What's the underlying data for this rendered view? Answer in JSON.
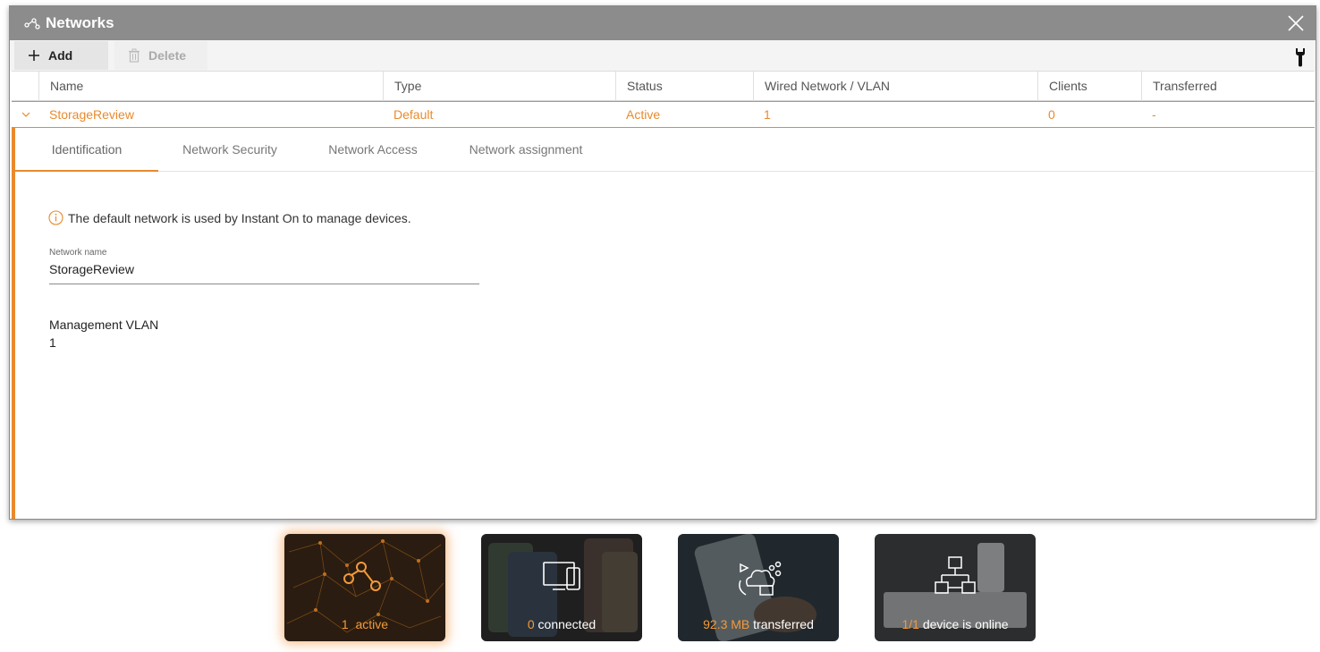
{
  "window": {
    "title": "Networks"
  },
  "toolbar": {
    "add_label": "Add",
    "delete_label": "Delete"
  },
  "table": {
    "columns": [
      "Name",
      "Type",
      "Status",
      "Wired Network / VLAN",
      "Clients",
      "Transferred"
    ],
    "rows": [
      {
        "name": "StorageReview",
        "type": "Default",
        "status": "Active",
        "vlan": "1",
        "clients": "0",
        "transferred": "-"
      }
    ]
  },
  "detail": {
    "tabs": [
      "Identification",
      "Network Security",
      "Network Access",
      "Network assignment"
    ],
    "active_tab": "Identification",
    "info_text": "The default network is used by Instant On to manage devices.",
    "network_name_label": "Network name",
    "network_name_value": "StorageReview",
    "management_vlan_label": "Management VLAN",
    "management_vlan_value": "1"
  },
  "tiles": [
    {
      "num": "1",
      "text": "active",
      "icon": "network-share-icon"
    },
    {
      "num": "0",
      "text": "connected",
      "icon": "devices-icon"
    },
    {
      "num": "92.3 MB",
      "text": "transferred",
      "icon": "cloud-traffic-icon"
    },
    {
      "num": "1/1",
      "text": "device is online",
      "icon": "network-topology-icon"
    }
  ],
  "colors": {
    "accent": "#e98a2c",
    "titlebar": "#8c8c8c"
  }
}
